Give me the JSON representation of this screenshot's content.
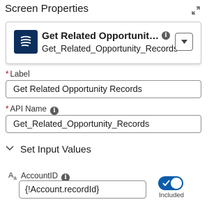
{
  "panel": {
    "title": "Screen Properties",
    "expand_icon": "expand-icon"
  },
  "element_card": {
    "icon": "get-records-icon",
    "icon_color": "#0b2e5c",
    "title": "Get Related Opportunity ...",
    "api_name": "Get_Related_Opportunity_Records",
    "info_icon": "info-icon",
    "dropdown_icon": "chevron-down-icon"
  },
  "label_field": {
    "required_marker": "*",
    "label": "Label",
    "value": "Get Related Opportunity Records"
  },
  "api_name_field": {
    "required_marker": "*",
    "label": "API Name",
    "info_icon": "info-icon",
    "value": "Get_Related_Opportunity_Records"
  },
  "input_values_section": {
    "title": "Set Input Values",
    "expanded": true,
    "parameters": [
      {
        "type_icon": "text-type-icon",
        "type_glyph": "A",
        "type_glyph_sub": "a",
        "label": "AccountID",
        "info_icon": "info-icon",
        "value": "{!Account.recordId}",
        "included": true,
        "included_label": "Included"
      }
    ]
  },
  "colors": {
    "toggle_on": "#0b5cab",
    "required": "#ba0517"
  }
}
